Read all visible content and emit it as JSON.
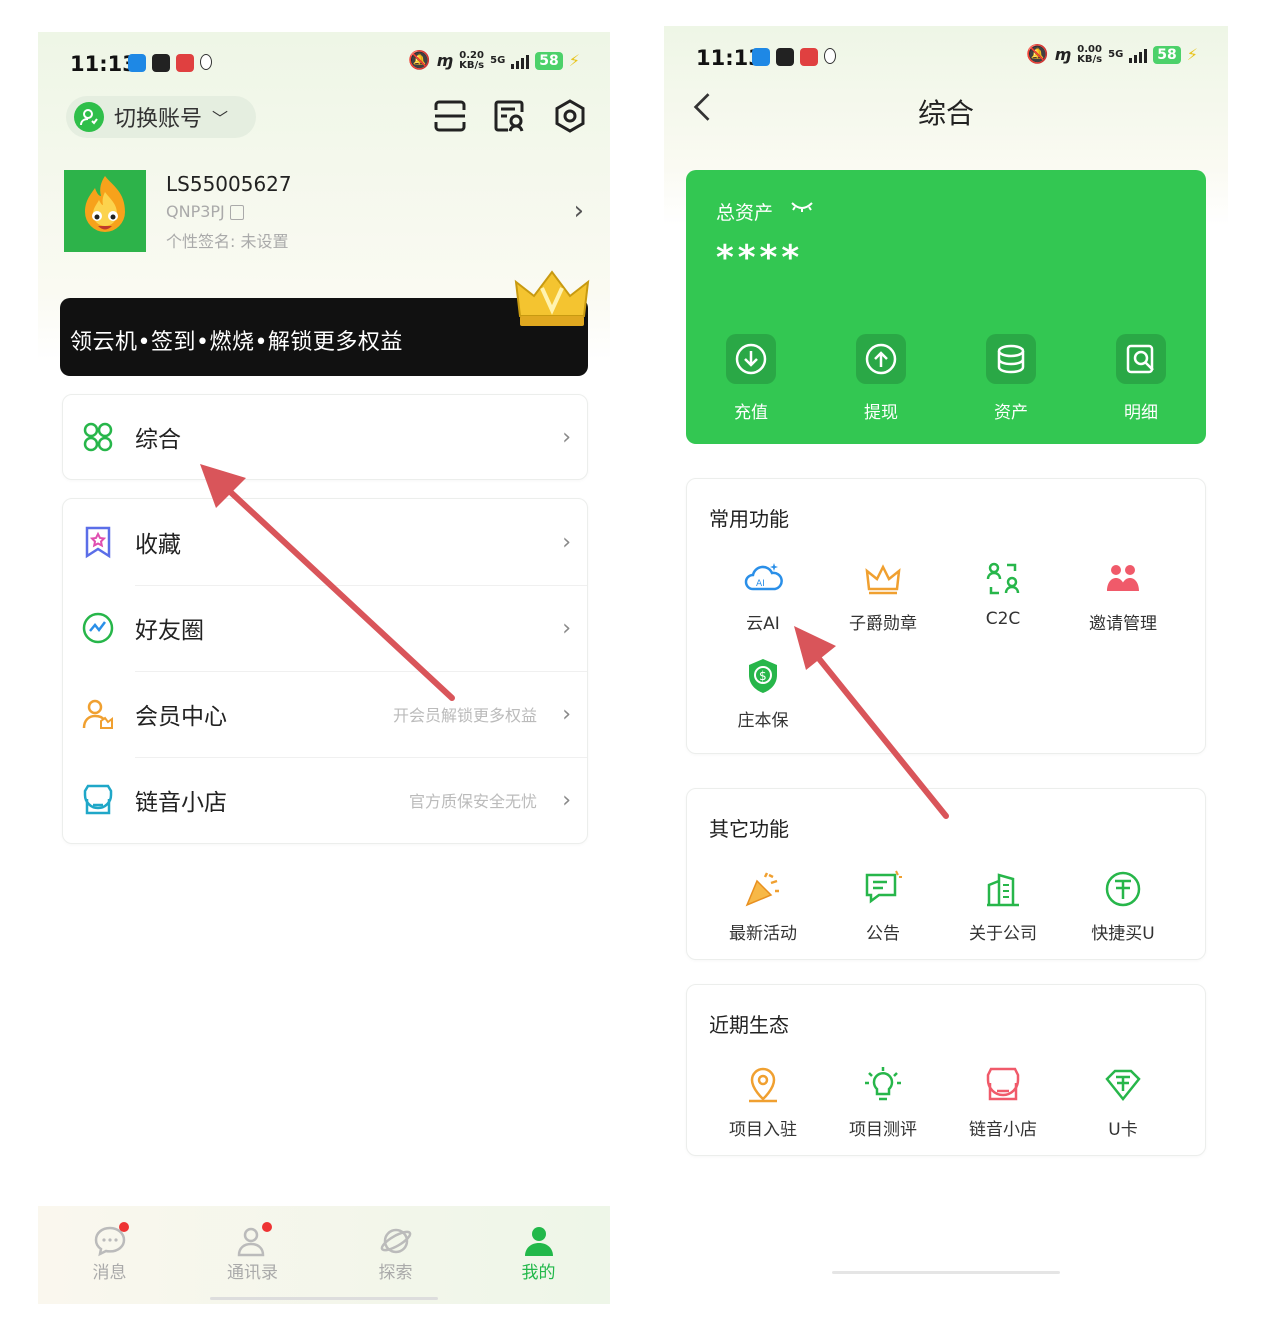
{
  "left": {
    "status": {
      "time": "11:13",
      "speed_top": "0.20",
      "speed_bottom": "KB/s",
      "net": "5G",
      "battery": "58"
    },
    "header": {
      "switch_account": "切换账号"
    },
    "profile": {
      "username": "LS55005627",
      "user_id": "QNP3PJ",
      "signature": "个性签名: 未设置"
    },
    "banner": {
      "text": "领云机•签到•燃烧•解锁更多权益"
    },
    "menu_single": {
      "label": "综合"
    },
    "menu": [
      {
        "label": "收藏",
        "hint": ""
      },
      {
        "label": "好友圈",
        "hint": ""
      },
      {
        "label": "会员中心",
        "hint": "开会员解锁更多权益"
      },
      {
        "label": "链音小店",
        "hint": "官方质保安全无忧"
      }
    ],
    "tabs": [
      {
        "label": "消息"
      },
      {
        "label": "通讯录"
      },
      {
        "label": "探索"
      },
      {
        "label": "我的"
      }
    ]
  },
  "right": {
    "status": {
      "time": "11:13",
      "speed_top": "0.00",
      "speed_bottom": "KB/s",
      "net": "5G",
      "battery": "58"
    },
    "title": "综合",
    "assets": {
      "label": "总资产",
      "value": "****",
      "actions": [
        {
          "label": "充值"
        },
        {
          "label": "提现"
        },
        {
          "label": "资产"
        },
        {
          "label": "明细"
        }
      ]
    },
    "common": {
      "title": "常用功能",
      "items": [
        {
          "label": "云AI"
        },
        {
          "label": "子爵勋章"
        },
        {
          "label": "C2C"
        },
        {
          "label": "邀请管理"
        },
        {
          "label": "庄本保"
        }
      ]
    },
    "other": {
      "title": "其它功能",
      "items": [
        {
          "label": "最新活动"
        },
        {
          "label": "公告"
        },
        {
          "label": "关于公司"
        },
        {
          "label": "快捷买U"
        }
      ]
    },
    "eco": {
      "title": "近期生态",
      "items": [
        {
          "label": "项目入驻"
        },
        {
          "label": "项目测评"
        },
        {
          "label": "链音小店"
        },
        {
          "label": "U卡"
        }
      ]
    }
  },
  "colors": {
    "brand_green": "#33c752",
    "arrow": "#d9555a",
    "accent_orange": "#f0a030"
  }
}
